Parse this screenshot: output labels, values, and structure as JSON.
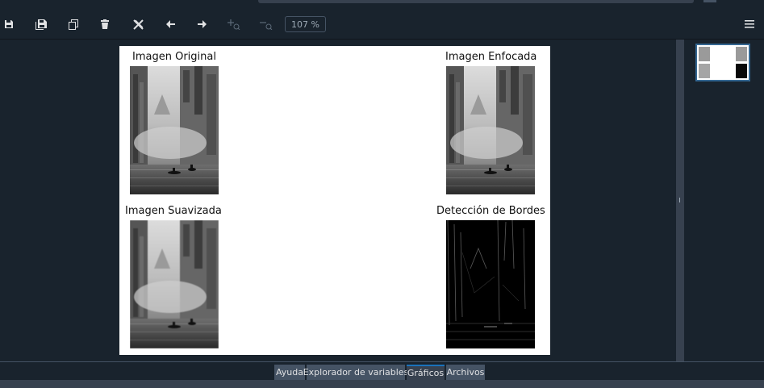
{
  "toolbar": {
    "buttons": [
      {
        "name": "save-icon"
      },
      {
        "name": "save-all-icon"
      },
      {
        "name": "copy-icon"
      },
      {
        "name": "delete-icon"
      },
      {
        "name": "delete-all-icon"
      },
      {
        "name": "arrow-left-icon"
      },
      {
        "name": "arrow-right-icon"
      },
      {
        "name": "zoom-in-icon"
      },
      {
        "name": "zoom-out-icon"
      }
    ],
    "zoom_value": "107 %",
    "menu_icon": "hamburger-menu-icon"
  },
  "figure": {
    "titles": {
      "original": "Imagen Original",
      "sharpened": "Imagen Enfocada",
      "smoothed": "Imagen Suavizada",
      "edges": "Detección de Bordes"
    }
  },
  "tabs": [
    {
      "label": "Ayuda",
      "active": false
    },
    {
      "label": "Explorador de variables",
      "active": false
    },
    {
      "label": "Gráficos",
      "active": true
    },
    {
      "label": "Archivos",
      "active": false
    }
  ],
  "colors": {
    "background": "#19232d",
    "panel": "#37414f",
    "tab": "#455364",
    "accent": "#1a72bb",
    "selection": "#346792"
  }
}
